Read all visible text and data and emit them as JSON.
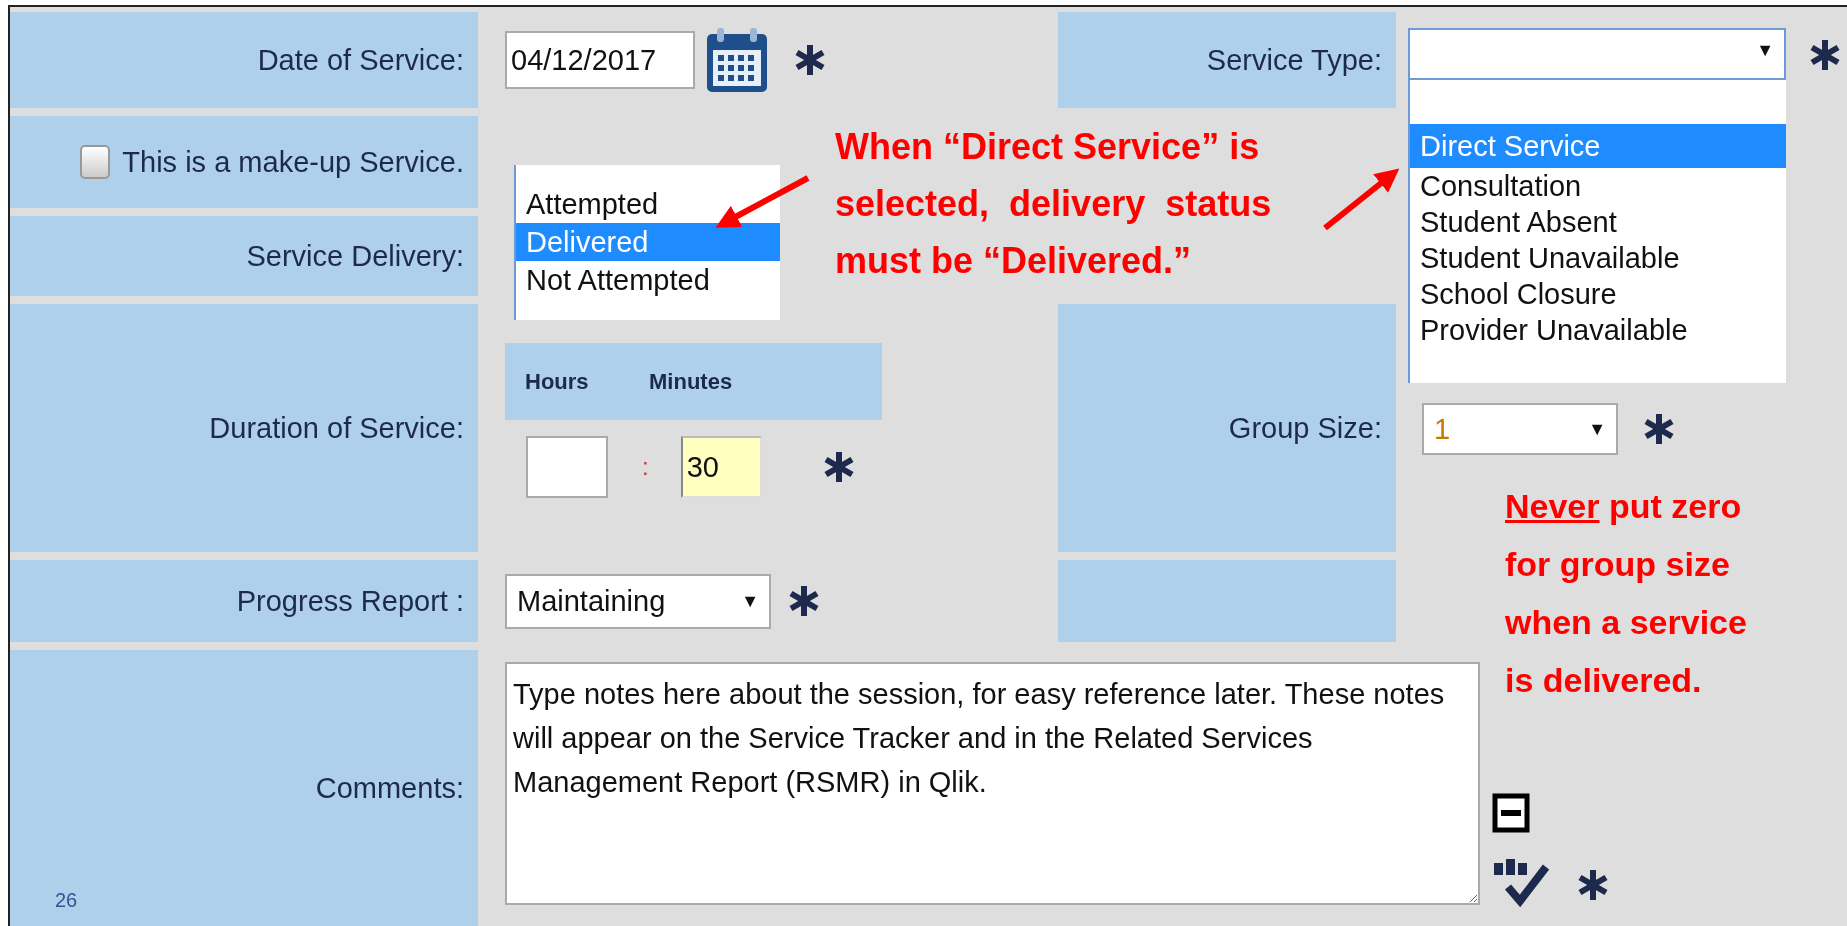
{
  "slide_number": "26",
  "date_of_service": {
    "label": "Date of Service:",
    "value": "04/12/2017",
    "required": true
  },
  "makeup": {
    "label": "This is a make-up Service.",
    "checked": false
  },
  "service_delivery": {
    "label": "Service Delivery:",
    "options": [
      {
        "label": "Attempted",
        "selected": false
      },
      {
        "label": "Delivered",
        "selected": true
      },
      {
        "label": "Not Attempted",
        "selected": false
      }
    ]
  },
  "duration": {
    "label": "Duration of Service:",
    "hours_label": "Hours",
    "minutes_label": "Minutes",
    "separator": ":",
    "minutes": "30",
    "required": true
  },
  "progress_report": {
    "label": "Progress Report :",
    "value": "Maintaining",
    "arrow": "▼",
    "required": true
  },
  "comments": {
    "label": "Comments:",
    "value": "Type notes here about the session, for easy reference later. These notes will appear on the Service Tracker and in the Related Services Management Report (RSMR) in Qlik.",
    "required": true
  },
  "service_type": {
    "label": "Service Type:",
    "arrow": "▼",
    "required": true,
    "options": [
      {
        "label": "Direct Service",
        "selected": true
      },
      {
        "label": "Consultation",
        "selected": false
      },
      {
        "label": "Student Absent",
        "selected": false
      },
      {
        "label": "Student Unavailable",
        "selected": false
      },
      {
        "label": "School Closure",
        "selected": false
      },
      {
        "label": "Provider Unavailable",
        "selected": false
      }
    ]
  },
  "group_size": {
    "label": "Group Size:",
    "value": "1",
    "arrow": "▼",
    "required": true
  },
  "callout": {
    "lines": [
      "When “Direct Service” is",
      "selected,  delivery  status",
      "must be “Delivered.”"
    ]
  },
  "note": {
    "emphasis": "Never",
    "text": "put zero for group size when a service is delivered."
  }
}
